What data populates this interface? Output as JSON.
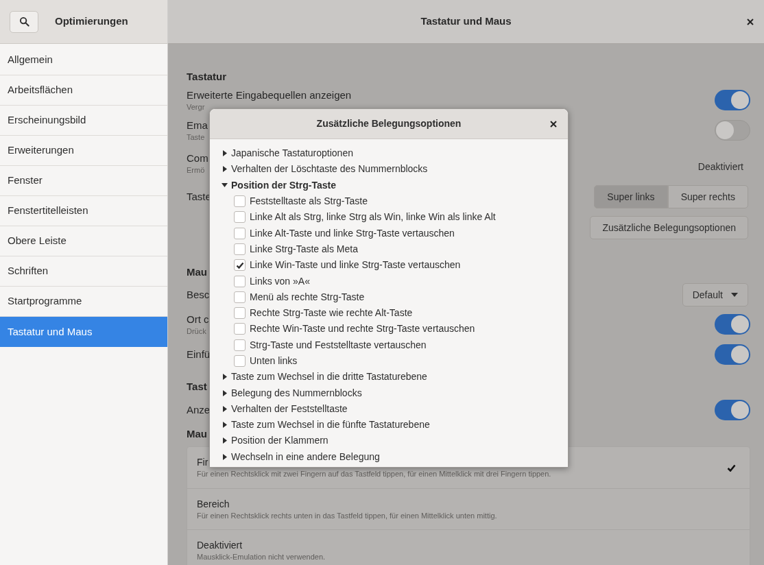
{
  "sidebar_header": {
    "title": "Optimierungen"
  },
  "main_header": {
    "title": "Tastatur und Maus"
  },
  "sidebar": {
    "items": [
      {
        "label": "Allgemein",
        "selected": false
      },
      {
        "label": "Arbeitsflächen",
        "selected": false
      },
      {
        "label": "Erscheinungsbild",
        "selected": false
      },
      {
        "label": "Erweiterungen",
        "selected": false
      },
      {
        "label": "Fenster",
        "selected": false
      },
      {
        "label": "Fenstertitelleisten",
        "selected": false
      },
      {
        "label": "Obere Leiste",
        "selected": false
      },
      {
        "label": "Schriften",
        "selected": false
      },
      {
        "label": "Startprogramme",
        "selected": false
      },
      {
        "label": "Tastatur und Maus",
        "selected": true
      }
    ]
  },
  "sections": [
    {
      "title": "Tastatur",
      "rows": [
        {
          "kind": "toggle",
          "label": "Erweiterte Eingabequellen anzeigen",
          "subtitle": "Vergr",
          "on": true
        },
        {
          "kind": "toggle",
          "label": "Ema",
          "subtitle": "Taste",
          "on": false
        },
        {
          "kind": "value",
          "label": "Com",
          "subtitle": "Ermö",
          "value": "Deaktiviert"
        },
        {
          "kind": "segmented",
          "label": "Taste",
          "options": [
            {
              "label": "Super links",
              "selected": true
            },
            {
              "label": "Super rechts",
              "selected": false
            }
          ]
        },
        {
          "kind": "button",
          "label": "Zusätzliche Belegungsoptionen"
        }
      ]
    },
    {
      "title": "Mau",
      "rows": [
        {
          "kind": "dropdown",
          "label": "Besc",
          "value": "Default"
        },
        {
          "kind": "toggle",
          "label": "Ort c",
          "subtitle": "Drück",
          "on": true
        },
        {
          "kind": "toggle",
          "label": "Einfü",
          "on": true
        }
      ]
    },
    {
      "title": "Tast",
      "rows": [
        {
          "kind": "toggle",
          "label": "Anze",
          "on": true
        }
      ]
    },
    {
      "title": "Mau",
      "rows": [
        {
          "kind": "choices",
          "items": [
            {
              "title": "Fir",
              "subtitle": "Für einen Rechtsklick mit zwei Fingern auf das Tastfeld tippen, für einen Mittelklick mit drei Fingern tippen.",
              "selected": true
            },
            {
              "title": "Bereich",
              "subtitle": "Für einen Rechtsklick rechts unten in das Tastfeld tippen, für einen Mittelklick unten mittig.",
              "selected": false
            },
            {
              "title": "Deaktiviert",
              "subtitle": "Mausklick-Emulation nicht verwenden.",
              "selected": false
            }
          ]
        }
      ]
    }
  ],
  "dialog": {
    "title": "Zusätzliche Belegungsoptionen",
    "items": [
      {
        "label": "Japanische Tastaturoptionen",
        "expanded": false
      },
      {
        "label": "Verhalten der Löschtaste des Nummernblocks",
        "expanded": false
      },
      {
        "label": "Position der Strg-Taste",
        "expanded": true,
        "children": [
          {
            "label": "Feststelltaste als Strg-Taste",
            "checked": false
          },
          {
            "label": "Linke Alt als Strg, linke Strg als Win, linke Win als linke Alt",
            "checked": false
          },
          {
            "label": "Linke Alt-Taste und linke Strg-Taste vertauschen",
            "checked": false
          },
          {
            "label": "Linke Strg-Taste als Meta",
            "checked": false
          },
          {
            "label": "Linke Win-Taste und linke Strg-Taste vertauschen",
            "checked": true
          },
          {
            "label": "Links von »A«",
            "checked": false
          },
          {
            "label": "Menü als rechte Strg-Taste",
            "checked": false
          },
          {
            "label": "Rechte Strg-Taste wie rechte Alt-Taste",
            "checked": false
          },
          {
            "label": "Rechte Win-Taste und rechte Strg-Taste vertauschen",
            "checked": false
          },
          {
            "label": "Strg-Taste und Feststelltaste vertauschen",
            "checked": false
          },
          {
            "label": "Unten links",
            "checked": false
          }
        ]
      },
      {
        "label": "Taste zum Wechsel in die dritte Tastaturebene",
        "expanded": false
      },
      {
        "label": "Belegung des Nummernblocks",
        "expanded": false
      },
      {
        "label": "Verhalten der Feststelltaste",
        "expanded": false
      },
      {
        "label": "Taste zum Wechsel in die fünfte Tastaturebene",
        "expanded": false
      },
      {
        "label": "Position der Klammern",
        "expanded": false
      },
      {
        "label": "Wechseln in eine andere Belegung",
        "expanded": false
      }
    ]
  }
}
